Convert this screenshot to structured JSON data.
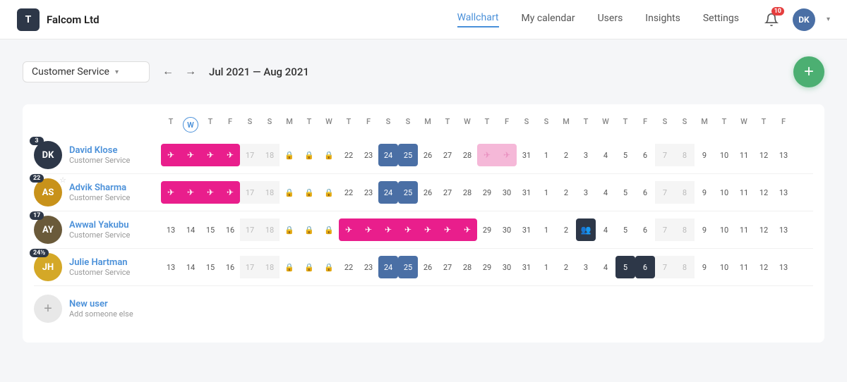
{
  "header": {
    "logo_letter": "T",
    "company": "Falcom Ltd",
    "nav": [
      {
        "label": "Wallchart",
        "active": true
      },
      {
        "label": "My calendar",
        "active": false
      },
      {
        "label": "Users",
        "active": false
      },
      {
        "label": "Insights",
        "active": false
      },
      {
        "label": "Settings",
        "active": false
      }
    ],
    "notif_count": "10",
    "user_initials": "DK"
  },
  "toolbar": {
    "department": "Customer Service",
    "date_range": "Jul 2021 — Aug 2021",
    "add_label": "+"
  },
  "calendar": {
    "day_headers": [
      {
        "label": "T",
        "day": "T",
        "today": false
      },
      {
        "label": "W",
        "day": "W",
        "today": true,
        "num": ""
      },
      {
        "label": "T",
        "today": false
      },
      {
        "label": "F",
        "today": false
      },
      {
        "label": "S",
        "today": false
      },
      {
        "label": "S",
        "today": false
      },
      {
        "label": "M",
        "today": false
      },
      {
        "label": "T",
        "today": false
      },
      {
        "label": "W",
        "today": false
      },
      {
        "label": "T",
        "today": false
      },
      {
        "label": "F",
        "today": false
      },
      {
        "label": "S",
        "today": false
      },
      {
        "label": "S",
        "today": false
      },
      {
        "label": "M",
        "today": false
      },
      {
        "label": "T",
        "today": false
      },
      {
        "label": "W",
        "today": false
      },
      {
        "label": "T",
        "today": false
      },
      {
        "label": "F",
        "today": false
      },
      {
        "label": "S",
        "today": false
      },
      {
        "label": "S",
        "today": false
      },
      {
        "label": "M",
        "today": false
      },
      {
        "label": "T",
        "today": false
      },
      {
        "label": "W",
        "today": false
      },
      {
        "label": "T",
        "today": false
      },
      {
        "label": "F",
        "today": false
      },
      {
        "label": "S",
        "today": false
      },
      {
        "label": "S",
        "today": false
      },
      {
        "label": "M",
        "today": false
      },
      {
        "label": "T",
        "today": false
      },
      {
        "label": "W",
        "today": false
      },
      {
        "label": "T",
        "today": false
      },
      {
        "label": "F",
        "today": false
      }
    ],
    "users": [
      {
        "id": "david",
        "name": "David Klose",
        "dept": "Customer Service",
        "initials": "DK",
        "avatar_bg": "#2d3748",
        "days_badge": "3",
        "has_star": false,
        "cells": [
          {
            "type": "leave",
            "icon": "✈"
          },
          {
            "type": "leave",
            "icon": "✈"
          },
          {
            "type": "leave",
            "icon": "✈"
          },
          {
            "type": "leave",
            "icon": "✈"
          },
          {
            "type": "num",
            "val": "17",
            "weekend": true
          },
          {
            "type": "num",
            "val": "18",
            "weekend": true
          },
          {
            "type": "lock"
          },
          {
            "type": "lock"
          },
          {
            "type": "lock"
          },
          {
            "type": "num",
            "val": "22"
          },
          {
            "type": "num",
            "val": "23"
          },
          {
            "type": "num",
            "val": "24",
            "highlight": true
          },
          {
            "type": "num",
            "val": "25",
            "highlight": true
          },
          {
            "type": "num",
            "val": "26"
          },
          {
            "type": "num",
            "val": "27"
          },
          {
            "type": "num",
            "val": "28"
          },
          {
            "type": "leave-light",
            "icon": "✈"
          },
          {
            "type": "leave-light",
            "icon": "✈"
          },
          {
            "type": "num",
            "val": "31"
          },
          {
            "type": "num",
            "val": "1"
          },
          {
            "type": "num",
            "val": "2"
          },
          {
            "type": "num",
            "val": "3"
          },
          {
            "type": "num",
            "val": "4"
          },
          {
            "type": "num",
            "val": "5"
          },
          {
            "type": "num",
            "val": "6"
          },
          {
            "type": "num",
            "val": "7",
            "weekend": true
          },
          {
            "type": "num",
            "val": "8",
            "weekend": true
          },
          {
            "type": "num",
            "val": "9"
          },
          {
            "type": "num",
            "val": "10"
          },
          {
            "type": "num",
            "val": "11"
          },
          {
            "type": "num",
            "val": "12"
          },
          {
            "type": "num",
            "val": "13"
          }
        ]
      },
      {
        "id": "advik",
        "name": "Advik Sharma",
        "dept": "Customer Service",
        "initials": "AS",
        "avatar_bg": "#e8a825",
        "days_badge": "22",
        "has_star": true,
        "cells": [
          {
            "type": "leave",
            "icon": "✈"
          },
          {
            "type": "leave",
            "icon": "✈"
          },
          {
            "type": "leave",
            "icon": "✈"
          },
          {
            "type": "leave",
            "icon": "✈"
          },
          {
            "type": "num",
            "val": "17",
            "weekend": true
          },
          {
            "type": "num",
            "val": "18",
            "weekend": true
          },
          {
            "type": "lock"
          },
          {
            "type": "lock"
          },
          {
            "type": "lock"
          },
          {
            "type": "num",
            "val": "22"
          },
          {
            "type": "num",
            "val": "23"
          },
          {
            "type": "num",
            "val": "24",
            "highlight": true
          },
          {
            "type": "num",
            "val": "25",
            "highlight": true
          },
          {
            "type": "num",
            "val": "26"
          },
          {
            "type": "num",
            "val": "27"
          },
          {
            "type": "num",
            "val": "28"
          },
          {
            "type": "num",
            "val": "29"
          },
          {
            "type": "num",
            "val": "30"
          },
          {
            "type": "num",
            "val": "31"
          },
          {
            "type": "num",
            "val": "1"
          },
          {
            "type": "num",
            "val": "2"
          },
          {
            "type": "num",
            "val": "3"
          },
          {
            "type": "num",
            "val": "4"
          },
          {
            "type": "num",
            "val": "5"
          },
          {
            "type": "num",
            "val": "6"
          },
          {
            "type": "num",
            "val": "7",
            "weekend": true
          },
          {
            "type": "num",
            "val": "8",
            "weekend": true
          },
          {
            "type": "num",
            "val": "9"
          },
          {
            "type": "num",
            "val": "10"
          },
          {
            "type": "num",
            "val": "11"
          },
          {
            "type": "num",
            "val": "12"
          },
          {
            "type": "num",
            "val": "13"
          }
        ]
      },
      {
        "id": "awwal",
        "name": "Awwal Yakubu",
        "dept": "Customer Service",
        "initials": "AY",
        "avatar_bg": "#5a8a6a",
        "days_badge": "17",
        "has_star": false,
        "cells": [
          {
            "type": "num",
            "val": "13"
          },
          {
            "type": "num",
            "val": "14"
          },
          {
            "type": "num",
            "val": "15"
          },
          {
            "type": "num",
            "val": "16"
          },
          {
            "type": "num",
            "val": "17",
            "weekend": true
          },
          {
            "type": "num",
            "val": "18",
            "weekend": true
          },
          {
            "type": "lock"
          },
          {
            "type": "lock"
          },
          {
            "type": "lock"
          },
          {
            "type": "leave",
            "icon": "✈"
          },
          {
            "type": "leave",
            "icon": "✈"
          },
          {
            "type": "leave",
            "icon": "✈"
          },
          {
            "type": "leave",
            "icon": "✈"
          },
          {
            "type": "leave",
            "icon": "✈"
          },
          {
            "type": "leave",
            "icon": "✈"
          },
          {
            "type": "leave",
            "icon": "✈"
          },
          {
            "type": "num",
            "val": "29"
          },
          {
            "type": "num",
            "val": "30"
          },
          {
            "type": "num",
            "val": "31"
          },
          {
            "type": "num",
            "val": "1"
          },
          {
            "type": "num",
            "val": "2"
          },
          {
            "type": "group",
            "icon": "👥"
          },
          {
            "type": "num",
            "val": "4"
          },
          {
            "type": "num",
            "val": "5"
          },
          {
            "type": "num",
            "val": "6"
          },
          {
            "type": "num",
            "val": "7",
            "weekend": true
          },
          {
            "type": "num",
            "val": "8",
            "weekend": true
          },
          {
            "type": "num",
            "val": "9"
          },
          {
            "type": "num",
            "val": "10"
          },
          {
            "type": "num",
            "val": "11"
          },
          {
            "type": "num",
            "val": "12"
          },
          {
            "type": "num",
            "val": "13"
          }
        ]
      },
      {
        "id": "julie",
        "name": "Julie Hartman",
        "dept": "Customer Service",
        "initials": "JH",
        "avatar_bg": "#e8c84a",
        "days_badge": "24½",
        "has_star": false,
        "cells": [
          {
            "type": "num",
            "val": "13"
          },
          {
            "type": "num",
            "val": "14"
          },
          {
            "type": "num",
            "val": "15"
          },
          {
            "type": "num",
            "val": "16"
          },
          {
            "type": "num",
            "val": "17",
            "weekend": true
          },
          {
            "type": "num",
            "val": "18",
            "weekend": true
          },
          {
            "type": "lock"
          },
          {
            "type": "lock"
          },
          {
            "type": "lock"
          },
          {
            "type": "num",
            "val": "22"
          },
          {
            "type": "num",
            "val": "23"
          },
          {
            "type": "num",
            "val": "24",
            "highlight": true
          },
          {
            "type": "num",
            "val": "25",
            "highlight": true
          },
          {
            "type": "num",
            "val": "26"
          },
          {
            "type": "num",
            "val": "27"
          },
          {
            "type": "num",
            "val": "28"
          },
          {
            "type": "num",
            "val": "29"
          },
          {
            "type": "num",
            "val": "30"
          },
          {
            "type": "num",
            "val": "31"
          },
          {
            "type": "num",
            "val": "1"
          },
          {
            "type": "num",
            "val": "2"
          },
          {
            "type": "num",
            "val": "3"
          },
          {
            "type": "num",
            "val": "4"
          },
          {
            "type": "num",
            "val": "5",
            "highlight2": true
          },
          {
            "type": "num",
            "val": "6",
            "highlight2": true
          },
          {
            "type": "num",
            "val": "7",
            "weekend": true
          },
          {
            "type": "num",
            "val": "8",
            "weekend": true
          },
          {
            "type": "num",
            "val": "9"
          },
          {
            "type": "num",
            "val": "10"
          },
          {
            "type": "num",
            "val": "11"
          },
          {
            "type": "num",
            "val": "12"
          },
          {
            "type": "num",
            "val": "13"
          }
        ]
      }
    ],
    "new_user": {
      "label": "New user",
      "sub": "Add someone else"
    }
  }
}
